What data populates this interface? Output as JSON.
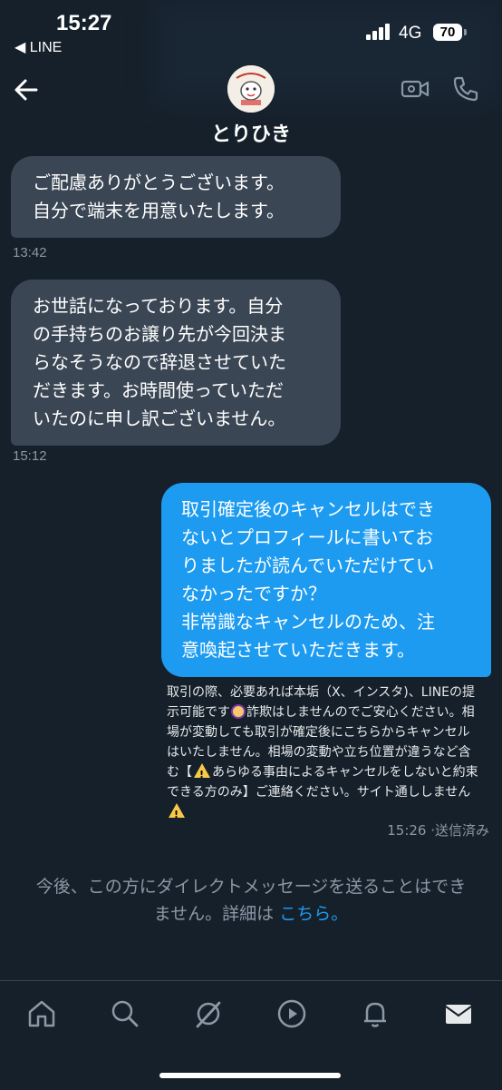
{
  "status_bar": {
    "time": "15:27",
    "back_app": "◀ LINE",
    "network": "4G",
    "battery": "70"
  },
  "header": {
    "contact_name": "とりひき"
  },
  "messages": [
    {
      "direction": "incoming",
      "lines": [
        "ご配慮ありがとうございます。",
        "自分で端末を用意いたします。"
      ],
      "time": "13:42"
    },
    {
      "direction": "incoming",
      "lines": [
        "お世話になっております。自分",
        "の手持ちのお譲り先が今回決ま",
        "らなそうなので辞退させていた",
        "だきます。お時間使っていただ",
        "いたのに申し訳ございません。"
      ],
      "time": "15:12"
    },
    {
      "direction": "outgoing",
      "lines": [
        "取引確定後のキャンセルはでき",
        "ないとプロフィールに書いてお",
        "りましたが読んでいただけてい",
        "なかったですか？",
        "非常識なキャンセルのため、注",
        "意喚起させていただきます。"
      ]
    }
  ],
  "profile_note": {
    "line1": "取引の際、必要あれば本垢（X、インスタ)、LINEの提",
    "line2_a": "示可能です",
    "line2_b": "詐欺はしませんのでご安心ください。相",
    "line3": "場が変動しても取引が確定後にこちらからキャンセル",
    "line4": "はいたしません。相場の変動や立ち位置が違うなど含",
    "line5_a": "む【",
    "line5_b": "あらゆる事由によるキャンセルをしないと約束",
    "line6": "できる方のみ】ご連絡ください。サイト通ししません"
  },
  "sent_status": "15:26 ·送信済み",
  "dm_notice": {
    "line1": "今後、この方にダイレクトメッセージを送ることはでき",
    "line2_prefix": "ません。詳細は ",
    "link": "こちら",
    "line2_suffix": "。"
  },
  "icons": {
    "nav": [
      "home-icon",
      "search-icon",
      "grok-icon",
      "play-icon",
      "bell-icon",
      "mail-icon"
    ],
    "header": [
      "back-arrow-icon",
      "video-call-icon",
      "phone-icon"
    ]
  },
  "colors": {
    "background": "#15202b",
    "incoming_bubble": "#3a4654",
    "outgoing_bubble": "#1d9bf0",
    "muted_text": "#8b98a5",
    "link": "#1d9bf0"
  }
}
